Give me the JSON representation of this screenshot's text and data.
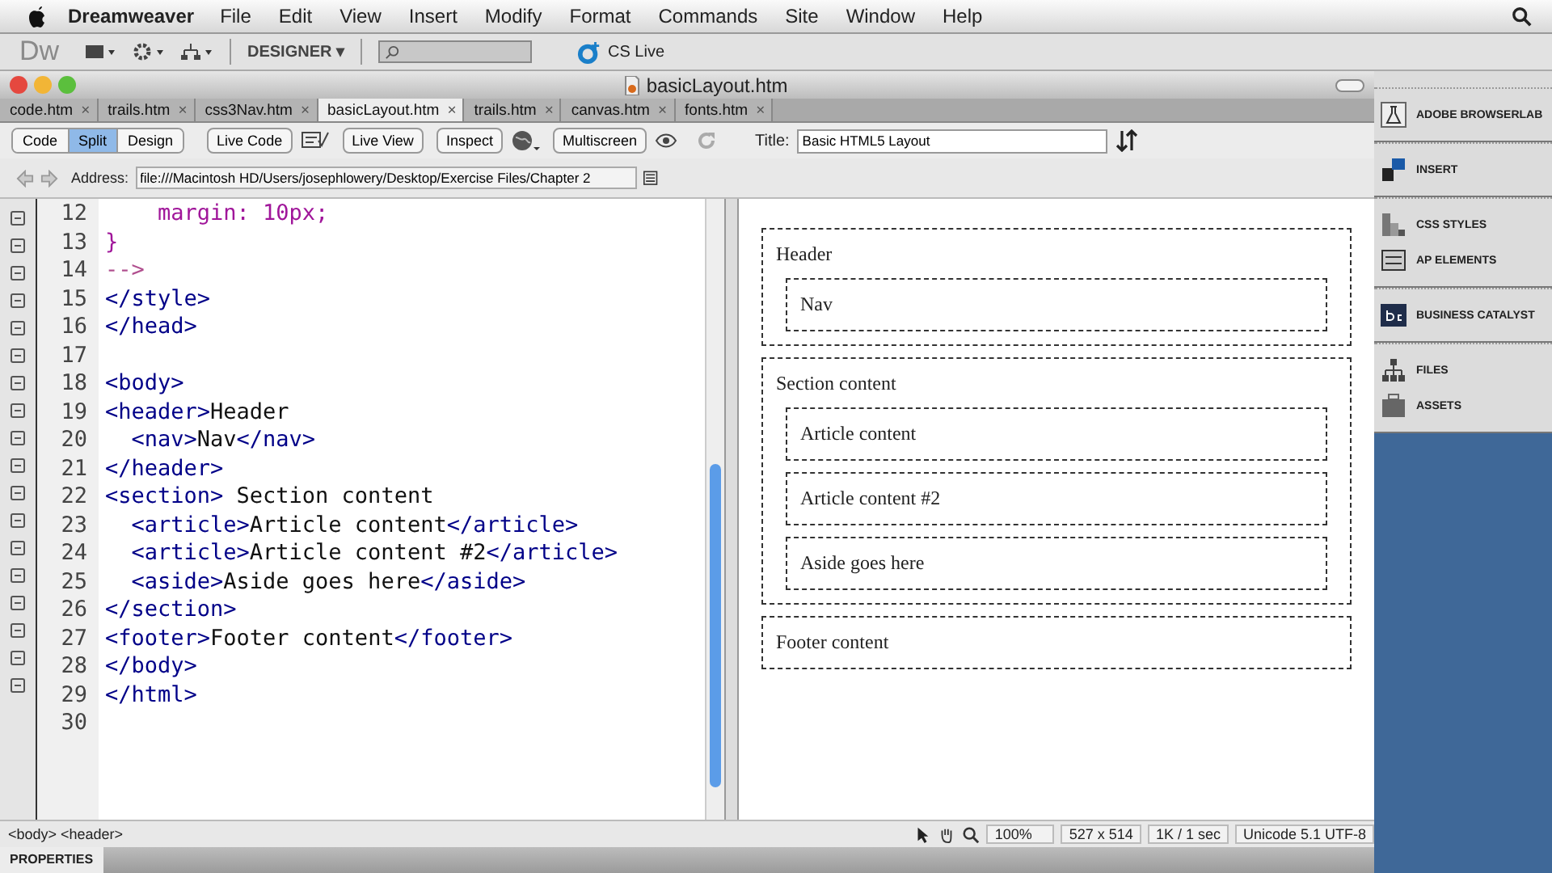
{
  "menu_bar": {
    "app_name": "Dreamweaver",
    "items": [
      "File",
      "Edit",
      "View",
      "Insert",
      "Modify",
      "Format",
      "Commands",
      "Site",
      "Window",
      "Help"
    ]
  },
  "app_toolbar": {
    "logo": "Dw",
    "workspace": "DESIGNER ▾",
    "cs_live": "CS Live"
  },
  "document": {
    "title": "basicLayout.htm",
    "tabs": [
      {
        "label": "code.htm",
        "close": "×",
        "selected": false
      },
      {
        "label": "trails.htm",
        "close": "×",
        "selected": false
      },
      {
        "label": "css3Nav.htm",
        "close": "×",
        "selected": false
      },
      {
        "label": "basicLayout.htm",
        "close": "×",
        "selected": true
      },
      {
        "label": "trails.htm",
        "close": "×",
        "selected": false
      },
      {
        "label": "canvas.htm",
        "close": "×",
        "selected": false
      },
      {
        "label": "fonts.htm",
        "close": "×",
        "selected": false
      }
    ],
    "view_buttons": [
      {
        "label": "Code",
        "selected": false
      },
      {
        "label": "Split",
        "selected": true
      },
      {
        "label": "Design",
        "selected": false
      }
    ],
    "toolbar_buttons": [
      "Live Code",
      "Live View",
      "Inspect",
      "Multiscreen"
    ],
    "title_label": "Title:",
    "title_value": "Basic HTML5 Layout",
    "address_label": "Address:",
    "address_value": "file:///Macintosh HD/Users/josephlowery/Desktop/Exercise Files/Chapter 2"
  },
  "code": {
    "lines": [
      {
        "number": "12",
        "tokens": [
          {
            "text": "    margin: 10px;",
            "kind": "css"
          }
        ]
      },
      {
        "number": "13",
        "tokens": [
          {
            "text": "}",
            "kind": "css"
          }
        ]
      },
      {
        "number": "14",
        "tokens": [
          {
            "text": "-->",
            "kind": "comment"
          }
        ]
      },
      {
        "number": "15",
        "tokens": [
          {
            "text": "</style>",
            "kind": "tag"
          }
        ]
      },
      {
        "number": "16",
        "tokens": [
          {
            "text": "</head>",
            "kind": "tag"
          }
        ]
      },
      {
        "number": "17"
      },
      {
        "number": "18",
        "tokens": [
          {
            "text": "<body>",
            "kind": "tag"
          }
        ]
      },
      {
        "number": "19",
        "tokens": [
          {
            "text": "<header>",
            "kind": "tag"
          },
          {
            "text": "Header",
            "kind": "text"
          }
        ]
      },
      {
        "number": "20",
        "tokens": [
          {
            "text": "  <nav>",
            "kind": "tag"
          },
          {
            "text": "Nav",
            "kind": "text"
          },
          {
            "text": "</nav>",
            "kind": "tag"
          }
        ]
      },
      {
        "number": "21",
        "tokens": [
          {
            "text": "</header>",
            "kind": "tag"
          }
        ]
      },
      {
        "number": "22",
        "tokens": [
          {
            "text": "<section>",
            "kind": "tag"
          },
          {
            "text": " Section content",
            "kind": "text"
          }
        ]
      },
      {
        "number": "23",
        "tokens": [
          {
            "text": "  <article>",
            "kind": "tag"
          },
          {
            "text": "Article content",
            "kind": "text"
          },
          {
            "text": "</article>",
            "kind": "tag"
          }
        ]
      },
      {
        "number": "24",
        "tokens": [
          {
            "text": "  <article>",
            "kind": "tag"
          },
          {
            "text": "Article content #2",
            "kind": "text"
          },
          {
            "text": "</article>",
            "kind": "tag"
          }
        ]
      },
      {
        "number": "25",
        "tokens": [
          {
            "text": "  <aside>",
            "kind": "tag"
          },
          {
            "text": "Aside goes here",
            "kind": "text"
          },
          {
            "text": "</aside>",
            "kind": "tag"
          }
        ]
      },
      {
        "number": "26",
        "tokens": [
          {
            "text": "</section>",
            "kind": "tag"
          }
        ]
      },
      {
        "number": "27",
        "tokens": [
          {
            "text": "<footer>",
            "kind": "tag"
          },
          {
            "text": "Footer content",
            "kind": "text"
          },
          {
            "text": "</footer>",
            "kind": "tag"
          }
        ]
      },
      {
        "number": "28",
        "tokens": [
          {
            "text": "</body>",
            "kind": "tag"
          }
        ]
      },
      {
        "number": "29",
        "tokens": [
          {
            "text": "</html>",
            "kind": "tag"
          }
        ]
      },
      {
        "number": "30"
      }
    ]
  },
  "design": {
    "header": {
      "label": "Header",
      "nav": "Nav"
    },
    "section": {
      "label": "Section content",
      "items": [
        "Article content",
        "Article content #2",
        "Aside goes here"
      ]
    },
    "footer": "Footer content"
  },
  "status_bar": {
    "tags": "<body> <header>",
    "zoom": "100%",
    "size": "527 x 514",
    "speed": "1K / 1 sec",
    "encoding": "Unicode 5.1 UTF-8"
  },
  "properties_tab": "PROPERTIES",
  "panels": [
    {
      "group": [
        {
          "label": "ADOBE BROWSERLAB",
          "kind": "lab"
        }
      ]
    },
    {
      "group": [
        {
          "label": "INSERT",
          "kind": "insert"
        }
      ]
    },
    {
      "group": [
        {
          "label": "CSS STYLES",
          "kind": "css"
        },
        {
          "label": "AP ELEMENTS",
          "kind": "ap"
        }
      ]
    },
    {
      "group": [
        {
          "label": "BUSINESS CATALYST",
          "kind": "bc"
        }
      ]
    },
    {
      "group": [
        {
          "label": "FILES",
          "kind": "files"
        },
        {
          "label": "ASSETS",
          "kind": "assets"
        }
      ]
    }
  ]
}
